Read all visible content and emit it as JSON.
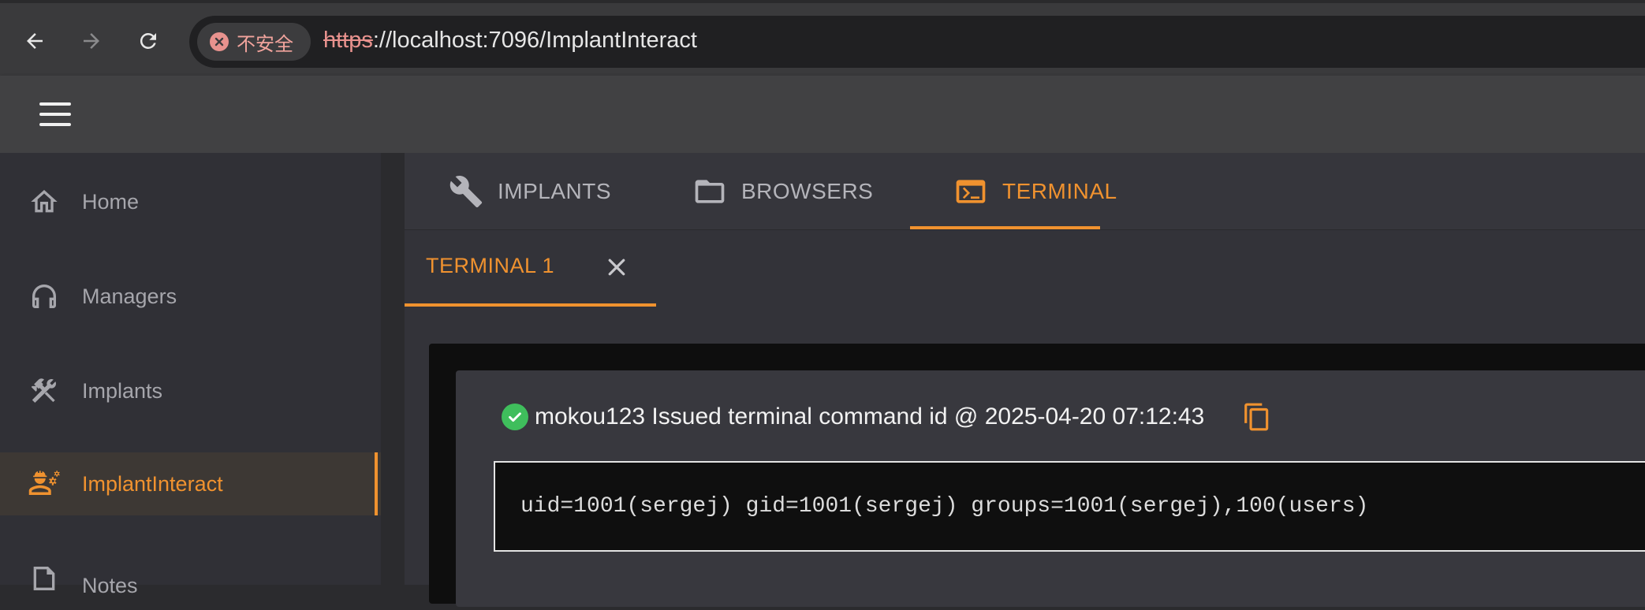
{
  "browser": {
    "security_label": "不安全",
    "url_scheme": "https",
    "url_rest": "://localhost:7096/ImplantInteract"
  },
  "sidebar": {
    "items": [
      {
        "label": "Home",
        "icon": "home-icon"
      },
      {
        "label": "Managers",
        "icon": "headphones-icon"
      },
      {
        "label": "Implants",
        "icon": "tools-icon"
      },
      {
        "label": "ImplantInteract",
        "icon": "user-gear-icon",
        "active": true
      },
      {
        "label": "Notes",
        "icon": "note-icon"
      }
    ]
  },
  "tabs": [
    {
      "label": "IMPLANTS",
      "icon": "wrench-icon"
    },
    {
      "label": "BROWSERS",
      "icon": "folder-icon"
    },
    {
      "label": "TERMINAL",
      "icon": "terminal-icon",
      "active": true
    }
  ],
  "terminal": {
    "tab_label": "TERMINAL 1",
    "command_text": "mokou123 Issued terminal command id @ 2025-04-20 07:12:43",
    "output": "uid=1001(sergej) gid=1001(sergej) groups=1001(sergej),100(users)"
  },
  "colors": {
    "accent": "#f0922f",
    "success": "#3fbe5c",
    "insecure": "#e8928e"
  }
}
